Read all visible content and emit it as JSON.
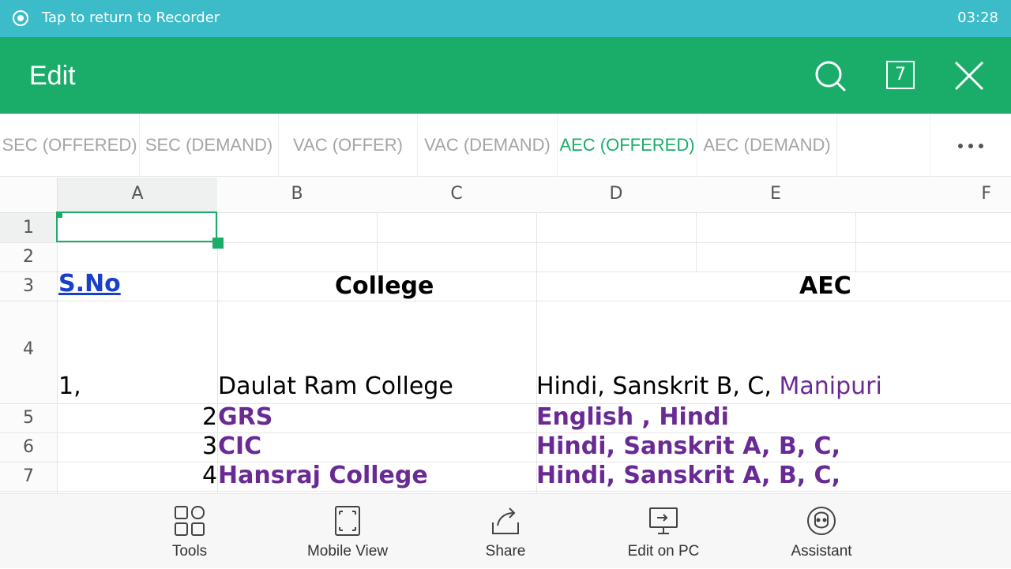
{
  "status_bar": {
    "text": "Tap to return to Recorder",
    "time": "03:28"
  },
  "app_bar": {
    "title": "Edit",
    "sheet_count": "7"
  },
  "sheet_tabs": [
    {
      "label": "SEC (OFFERED)",
      "active": false
    },
    {
      "label": "SEC (DEMAND)",
      "active": false
    },
    {
      "label": "VAC (OFFER)",
      "active": false
    },
    {
      "label": "VAC (DEMAND)",
      "active": false
    },
    {
      "label": "AEC (OFFERED)",
      "active": true
    },
    {
      "label": "AEC (DEMAND)",
      "active": false
    }
  ],
  "grid": {
    "columns": [
      "A",
      "B",
      "C",
      "D",
      "E",
      "F"
    ],
    "rows": [
      "1",
      "2",
      "3",
      "4",
      "5",
      "6",
      "7"
    ],
    "cells": {
      "a3": "S.No",
      "b3": "College",
      "d3": "AEC",
      "a4": "1,",
      "b4": "Daulat Ram College",
      "d4_black": "Hindi, Sanskrit  B, C, ",
      "d4_purple": "Manipuri",
      "a5": "2",
      "b5": "GRS",
      "d5": "English , Hindi",
      "a6": "3",
      "b6": "CIC",
      "d6": "Hindi, Sanskrit A, B, C,",
      "a7": "4",
      "b7": "Hansraj College",
      "d7": "Hindi, Sanskrit A, B, C,"
    },
    "colors": {
      "accent": "#1aad6a",
      "purple": "#6a2a93",
      "link": "#1a3fcc"
    }
  },
  "toolbar": {
    "items": [
      {
        "label": "Tools",
        "icon": "tools-grid-icon"
      },
      {
        "label": "Mobile View",
        "icon": "mobile-view-icon"
      },
      {
        "label": "Share",
        "icon": "share-icon"
      },
      {
        "label": "Edit on PC",
        "icon": "edit-on-pc-icon"
      },
      {
        "label": "Assistant",
        "icon": "assistant-icon"
      }
    ]
  }
}
